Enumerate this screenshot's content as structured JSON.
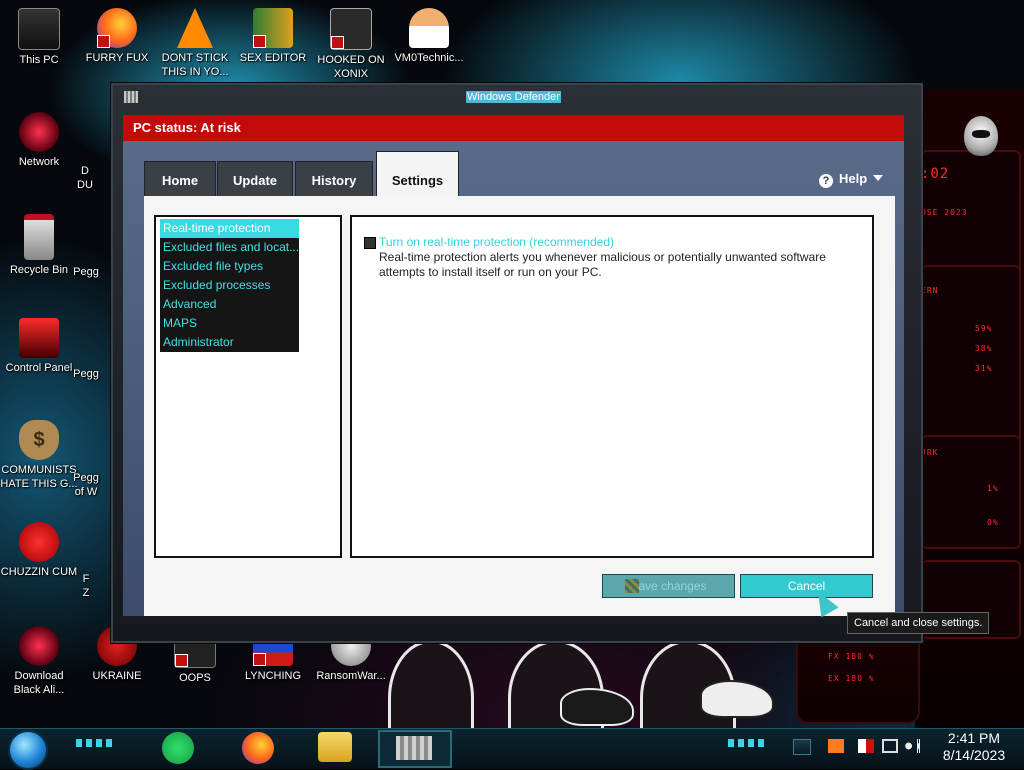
{
  "desktop": {
    "icons": [
      {
        "label": "This PC"
      },
      {
        "label": "FURRY FUX"
      },
      {
        "label": "DONT STICK THIS IN YO..."
      },
      {
        "label": "SEX EDITOR"
      },
      {
        "label": "HOOKED ON XONIX"
      },
      {
        "label": "VM0Technic..."
      },
      {
        "label": "Network"
      },
      {
        "label": "Recycle Bin"
      },
      {
        "label": "Control Panel"
      },
      {
        "label": "COMMUNISTS HATE THIS G..."
      },
      {
        "label": "CHUZZIN CUM"
      },
      {
        "label": "Download Black Ali..."
      },
      {
        "label": "UKRAINE"
      },
      {
        "label": "OOPS"
      },
      {
        "label": "LYNCHING"
      },
      {
        "label": "RansomWar..."
      }
    ],
    "partial_labels": {
      "d1": "D",
      "d2": "DU",
      "p1": "Pegg",
      "p2": "Pegg",
      "p3": "Pegg",
      "p4": "Pegg",
      "w": "of W",
      "f1": "F",
      "f2": "Z"
    }
  },
  "window": {
    "title": "Windows Defender",
    "status": "PC status: At risk",
    "tabs": [
      {
        "label": "Home"
      },
      {
        "label": "Update"
      },
      {
        "label": "History"
      },
      {
        "label": "Settings",
        "active": true
      }
    ],
    "help_label": "Help",
    "settings_menu": [
      {
        "label": "Real-time protection",
        "selected": true
      },
      {
        "label": "Excluded files and locat..."
      },
      {
        "label": "Excluded file types"
      },
      {
        "label": "Excluded processes"
      },
      {
        "label": "Advanced"
      },
      {
        "label": "MAPS"
      },
      {
        "label": "Administrator"
      }
    ],
    "realtime": {
      "checkbox_label": "Turn on real-time protection (recommended)",
      "checked": true,
      "description": "Real-time protection alerts you whenever malicious or potentially unwanted software attempts to install itself or run on your PC."
    },
    "buttons": {
      "save": "Save changes",
      "cancel": "Cancel"
    },
    "tooltip": "Cancel and close settings."
  },
  "hud": {
    "readouts": [
      ":02",
      "USE 2023",
      "ERN",
      "59%",
      "38%",
      "31%",
      "JRK",
      "1%",
      "0%",
      "EX",
      "FX 180 %",
      "EX 180 %"
    ]
  },
  "taskbar": {
    "time": "2:41 PM",
    "date": "8/14/2023",
    "apps": [
      "spotify-icon",
      "firefox-icon",
      "file-explorer-icon",
      "windows-defender-icon"
    ]
  },
  "colors": {
    "status_red": "#c30a0a",
    "accent_cyan": "#37d9e3",
    "taskbar": "#0c2430"
  }
}
